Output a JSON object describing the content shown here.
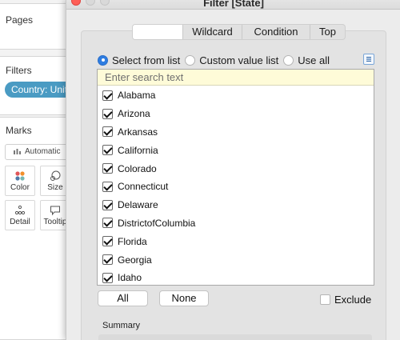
{
  "background": {
    "pages_title": "Pages",
    "filters_title": "Filters",
    "filter_pill": "Country: United States",
    "marks_title": "Marks",
    "marks_type": "Automatic",
    "marks_buttons": {
      "color": "Color",
      "size": "Size",
      "detail": "Detail",
      "tooltip": "Tooltip"
    }
  },
  "dialog": {
    "title": "Filter [State]",
    "tabs": {
      "general": "",
      "wildcard": "Wildcard",
      "condition": "Condition",
      "top": "Top"
    },
    "mode": {
      "select_from_list": "Select from list",
      "custom_value_list": "Custom value list",
      "use_all": "Use all",
      "selected": "select_from_list"
    },
    "search_placeholder": "Enter search text",
    "items": [
      {
        "label": "Alabama",
        "checked": true
      },
      {
        "label": "Arizona",
        "checked": true
      },
      {
        "label": "Arkansas",
        "checked": true
      },
      {
        "label": "California",
        "checked": true
      },
      {
        "label": "Colorado",
        "checked": true
      },
      {
        "label": "Connecticut",
        "checked": true
      },
      {
        "label": "Delaware",
        "checked": true
      },
      {
        "label": "DistrictofColumbia",
        "checked": true
      },
      {
        "label": "Florida",
        "checked": true
      },
      {
        "label": "Georgia",
        "checked": true
      },
      {
        "label": "Idaho",
        "checked": true
      }
    ],
    "all_label": "All",
    "none_label": "None",
    "exclude_label": "Exclude",
    "exclude_checked": false,
    "summary_label": "Summary"
  },
  "colors": {
    "accent": "#2f7de1",
    "pill": "#4a9bc3",
    "close": "#fe5f57",
    "search_bg": "#fefbd8"
  },
  "icons": [
    "bar-chart-icon",
    "color-dots-icon",
    "size-icon",
    "detail-icon",
    "tooltip-icon",
    "list-options-icon"
  ]
}
